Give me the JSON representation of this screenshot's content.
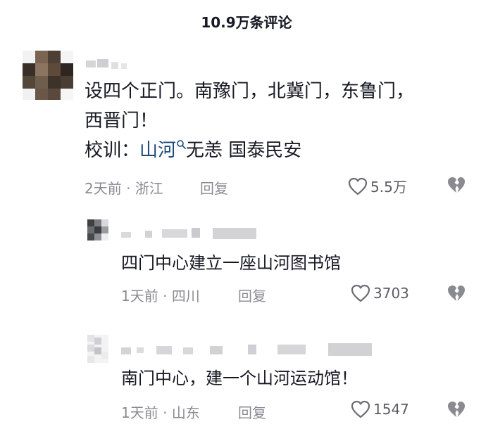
{
  "header": {
    "title": "10.9万条评论"
  },
  "comments": [
    {
      "text_line1": "设四个正门。南豫门，北冀门，东鲁门，",
      "text_line2": "西晋门！",
      "motto_prefix": "校训：",
      "motto_link": "山河",
      "motto_rest": "无恙 国泰民安",
      "time": "2天前",
      "location": "浙江",
      "reply_label": "回复",
      "likes": "5.5万"
    }
  ],
  "replies": [
    {
      "text": "四门中心建立一座山河图书馆",
      "time": "1天前",
      "location": "四川",
      "reply_label": "回复",
      "likes": "3703"
    },
    {
      "text": "南门中心，建一个山河运动馆！",
      "time": "1天前",
      "location": "山东",
      "reply_label": "回复",
      "likes": "1547"
    }
  ],
  "colors": {
    "text": "#161823",
    "meta": "#8a8b91",
    "link": "#1c4a7a"
  },
  "icons": {
    "like": "heart-outline-icon",
    "dislike": "broken-heart-icon",
    "search": "search-icon"
  },
  "meta_separator": "·"
}
